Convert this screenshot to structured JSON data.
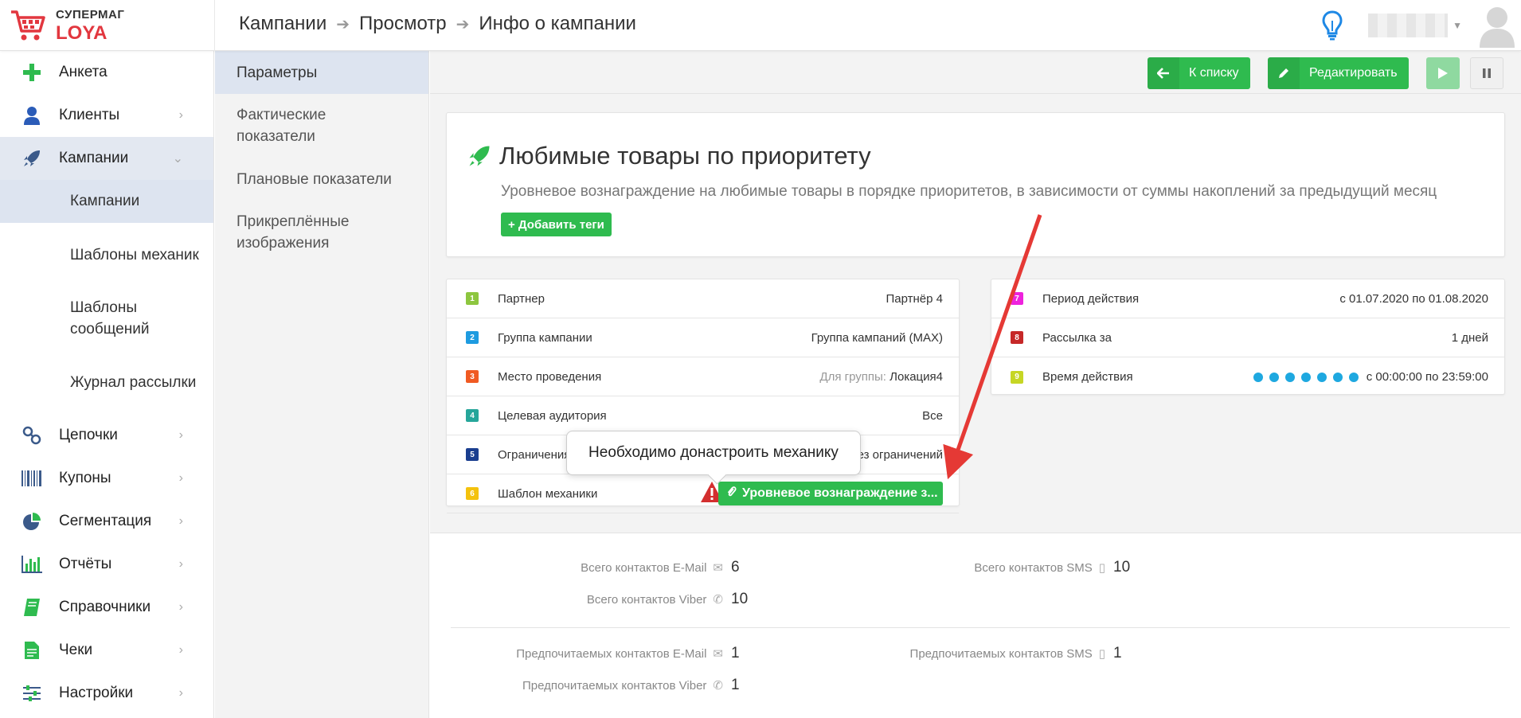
{
  "logo": {
    "top": "СУПЕРМАГ",
    "bottom": "LOYA"
  },
  "breadcrumb": [
    "Кампании",
    "Просмотр",
    "Инфо о кампании"
  ],
  "sidebar": {
    "items": [
      {
        "label": "Анкета"
      },
      {
        "label": "Клиенты"
      },
      {
        "label": "Кампании"
      },
      {
        "label": "Цепочки"
      },
      {
        "label": "Купоны"
      },
      {
        "label": "Сегментация"
      },
      {
        "label": "Отчёты"
      },
      {
        "label": "Справочники"
      },
      {
        "label": "Чеки"
      },
      {
        "label": "Настройки"
      }
    ],
    "subitems": [
      {
        "label": "Кампании"
      },
      {
        "label": "Шаблоны механик"
      },
      {
        "label": "Шаблоны сообщений"
      },
      {
        "label": "Журнал рассылки"
      }
    ]
  },
  "subnav": {
    "items": [
      {
        "label": "Параметры"
      },
      {
        "label": "Фактические показатели"
      },
      {
        "label": "Плановые показатели"
      },
      {
        "label": "Прикреплённые изображения"
      }
    ]
  },
  "toolbar": {
    "back_label": "К списку",
    "edit_label": "Редактировать"
  },
  "campaign": {
    "title": "Любимые товары по приоритету",
    "description": "Уровневое вознаграждение на любимые товары в порядке приоритетов, в зависимости от суммы накоплений за предыдущий месяц",
    "add_tags": "+ Добавить теги"
  },
  "params_left": [
    {
      "num": "1",
      "color": "#8dc63f",
      "label": "Партнер",
      "value": "Партнёр 4"
    },
    {
      "num": "2",
      "color": "#1e9be0",
      "label": "Группа кампании",
      "value": "Группа кампаний (MAX)"
    },
    {
      "num": "3",
      "color": "#f05a22",
      "label": "Место проведения",
      "prefix": "Для группы:",
      "value": "Локация4"
    },
    {
      "num": "4",
      "color": "#26a69a",
      "label": "Целевая аудитория",
      "value": "Все"
    },
    {
      "num": "5",
      "color": "#1a3e8f",
      "label": "Ограничения",
      "value": "Без ограничений"
    },
    {
      "num": "6",
      "color": "#f4c20d",
      "label": "Шаблон механики",
      "value": "Уровневое вознаграждение з..."
    }
  ],
  "params_right": [
    {
      "num": "7",
      "color": "#ee22dd",
      "label": "Период действия",
      "value": "с 01.07.2020 по 01.08.2020"
    },
    {
      "num": "8",
      "color": "#c62828",
      "label": "Рассылка за",
      "value": "1 дней"
    },
    {
      "num": "9",
      "color": "#c6d624",
      "label": "Время действия",
      "value": "с 00:00:00 по 23:59:00"
    }
  ],
  "tooltip": "Необходимо донастроить механику",
  "stats": {
    "email_total_label": "Всего контактов E-Mail",
    "email_total": "6",
    "sms_total_label": "Всего контактов SMS",
    "sms_total": "10",
    "viber_total_label": "Всего контактов Viber",
    "viber_total": "10",
    "email_pref_label": "Предпочитаемых контактов E-Mail",
    "email_pref": "1",
    "sms_pref_label": "Предпочитаемых контактов SMS",
    "sms_pref": "1",
    "viber_pref_label": "Предпочитаемых контактов Viber",
    "viber_pref": "1"
  },
  "colors": {
    "green": "#2fbb4f",
    "accent_red": "#e2373f",
    "annotation_arrow": "#e53935"
  }
}
